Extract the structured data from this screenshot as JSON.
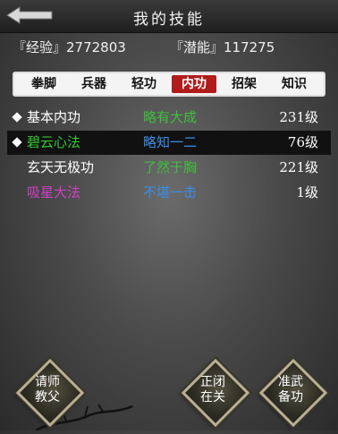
{
  "header": {
    "title": "我的技能"
  },
  "stats": {
    "exp": "『经验』2772803",
    "potential": "『潜能』117275"
  },
  "tabs": [
    "拳脚",
    "兵器",
    "轻功",
    "内功",
    "招架",
    "知识"
  ],
  "active_tab": "内功",
  "skills": [
    {
      "name": "基本内功",
      "desc": "略有大成",
      "level": "231级",
      "name_color": "#ffffff",
      "desc_color": "#3fbf3f",
      "marked": true,
      "selected": false
    },
    {
      "name": "碧云心法",
      "desc": "略知一二",
      "level": "76级",
      "name_color": "#35c935",
      "desc_color": "#3a8ee6",
      "marked": true,
      "selected": true
    },
    {
      "name": "玄天无极功",
      "desc": "了然于胸",
      "level": "221级",
      "name_color": "#ffffff",
      "desc_color": "#3fbf3f",
      "marked": false,
      "selected": false
    },
    {
      "name": "吸星大法",
      "desc": "不堪一击",
      "level": "1级",
      "name_color": "#d040c8",
      "desc_color": "#3a8ee6",
      "marked": false,
      "selected": false
    }
  ],
  "buttons": {
    "master": "请师\n教父",
    "close": "正闭\n在关",
    "prepare": "准武\n备功"
  },
  "icons": {
    "back": "back-arrow-icon",
    "marker": "diamond-icon"
  }
}
